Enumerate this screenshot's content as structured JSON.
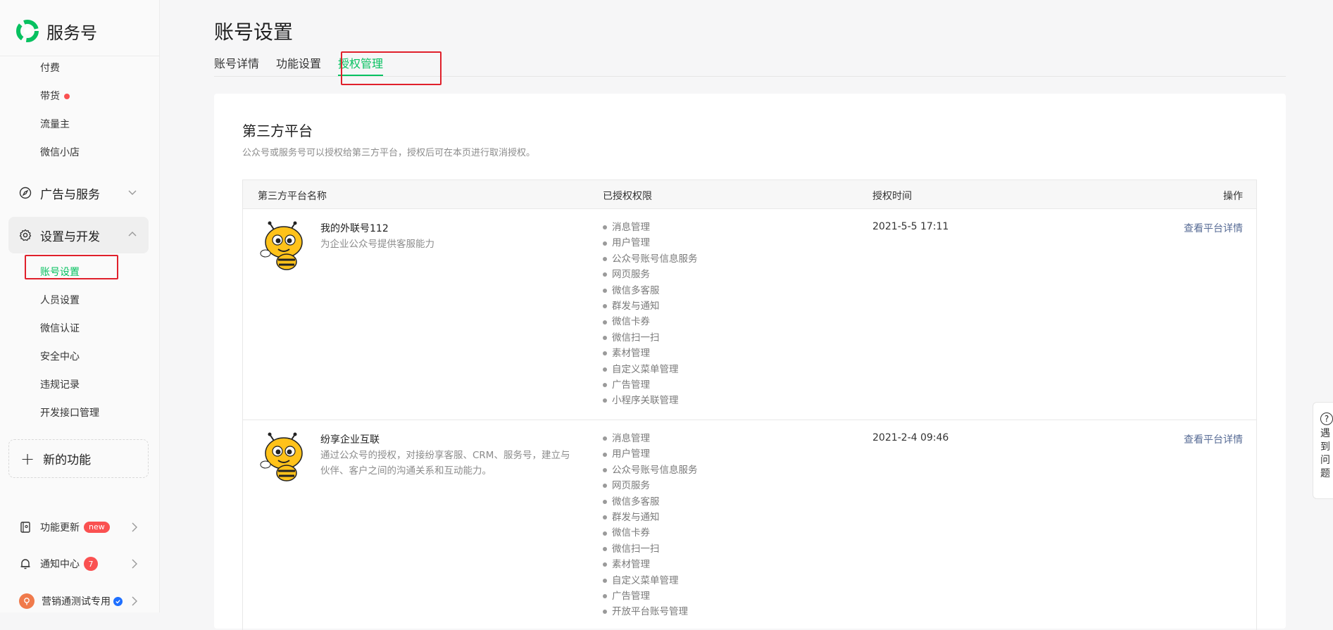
{
  "app": {
    "name": "服务号"
  },
  "sidebar": {
    "sub_items_top": [
      {
        "label": "付费"
      },
      {
        "label": "带货"
      },
      {
        "label": "流量主"
      },
      {
        "label": "微信小店"
      }
    ],
    "groups": {
      "ads": {
        "label": "广告与服务"
      },
      "settings": {
        "label": "设置与开发"
      }
    },
    "settings_items": [
      {
        "label": "账号设置"
      },
      {
        "label": "人员设置"
      },
      {
        "label": "微信认证"
      },
      {
        "label": "安全中心"
      },
      {
        "label": "违规记录"
      },
      {
        "label": "开发接口管理"
      }
    ],
    "new_feature": {
      "label": "新的功能"
    },
    "bottom": {
      "updates": {
        "label": "功能更新",
        "badge": "new"
      },
      "notifications": {
        "label": "通知中心",
        "badge": "7"
      },
      "account": {
        "label": "营销通测试专用"
      }
    }
  },
  "page": {
    "title": "账号设置",
    "tabs": [
      {
        "label": "账号详情"
      },
      {
        "label": "功能设置"
      },
      {
        "label": "授权管理"
      }
    ]
  },
  "section": {
    "title": "第三方平台",
    "desc": "公众号或服务号可以授权给第三方平台，授权后可在本页进行取消授权。"
  },
  "table": {
    "headers": {
      "name": "第三方平台名称",
      "perms": "已授权权限",
      "time": "授权时间",
      "op": "操作"
    },
    "rows": [
      {
        "name": "我的外联号112",
        "desc": "为企业公众号提供客服能力",
        "perms": [
          "消息管理",
          "用户管理",
          "公众号账号信息服务",
          "网页服务",
          "微信多客服",
          "群发与通知",
          "微信卡券",
          "微信扫一扫",
          "素材管理",
          "自定义菜单管理",
          "广告管理",
          "小程序关联管理"
        ],
        "time": "2021-5-5 17:11",
        "op": "查看平台详情"
      },
      {
        "name": "纷享企业互联",
        "desc": "通过公众号的授权，对接纷享客服、CRM、服务号，建立与伙伴、客户之间的沟通关系和互动能力。",
        "perms": [
          "消息管理",
          "用户管理",
          "公众号账号信息服务",
          "网页服务",
          "微信多客服",
          "群发与通知",
          "微信卡券",
          "微信扫一扫",
          "素材管理",
          "自定义菜单管理",
          "广告管理",
          "开放平台账号管理"
        ],
        "time": "2021-2-4 09:46",
        "op": "查看平台详情"
      }
    ]
  },
  "help": {
    "text": "遇到问题"
  },
  "colors": {
    "accent": "#07c160",
    "link": "#576b95",
    "highlight": "#e0202b",
    "badge": "#fa5151"
  }
}
